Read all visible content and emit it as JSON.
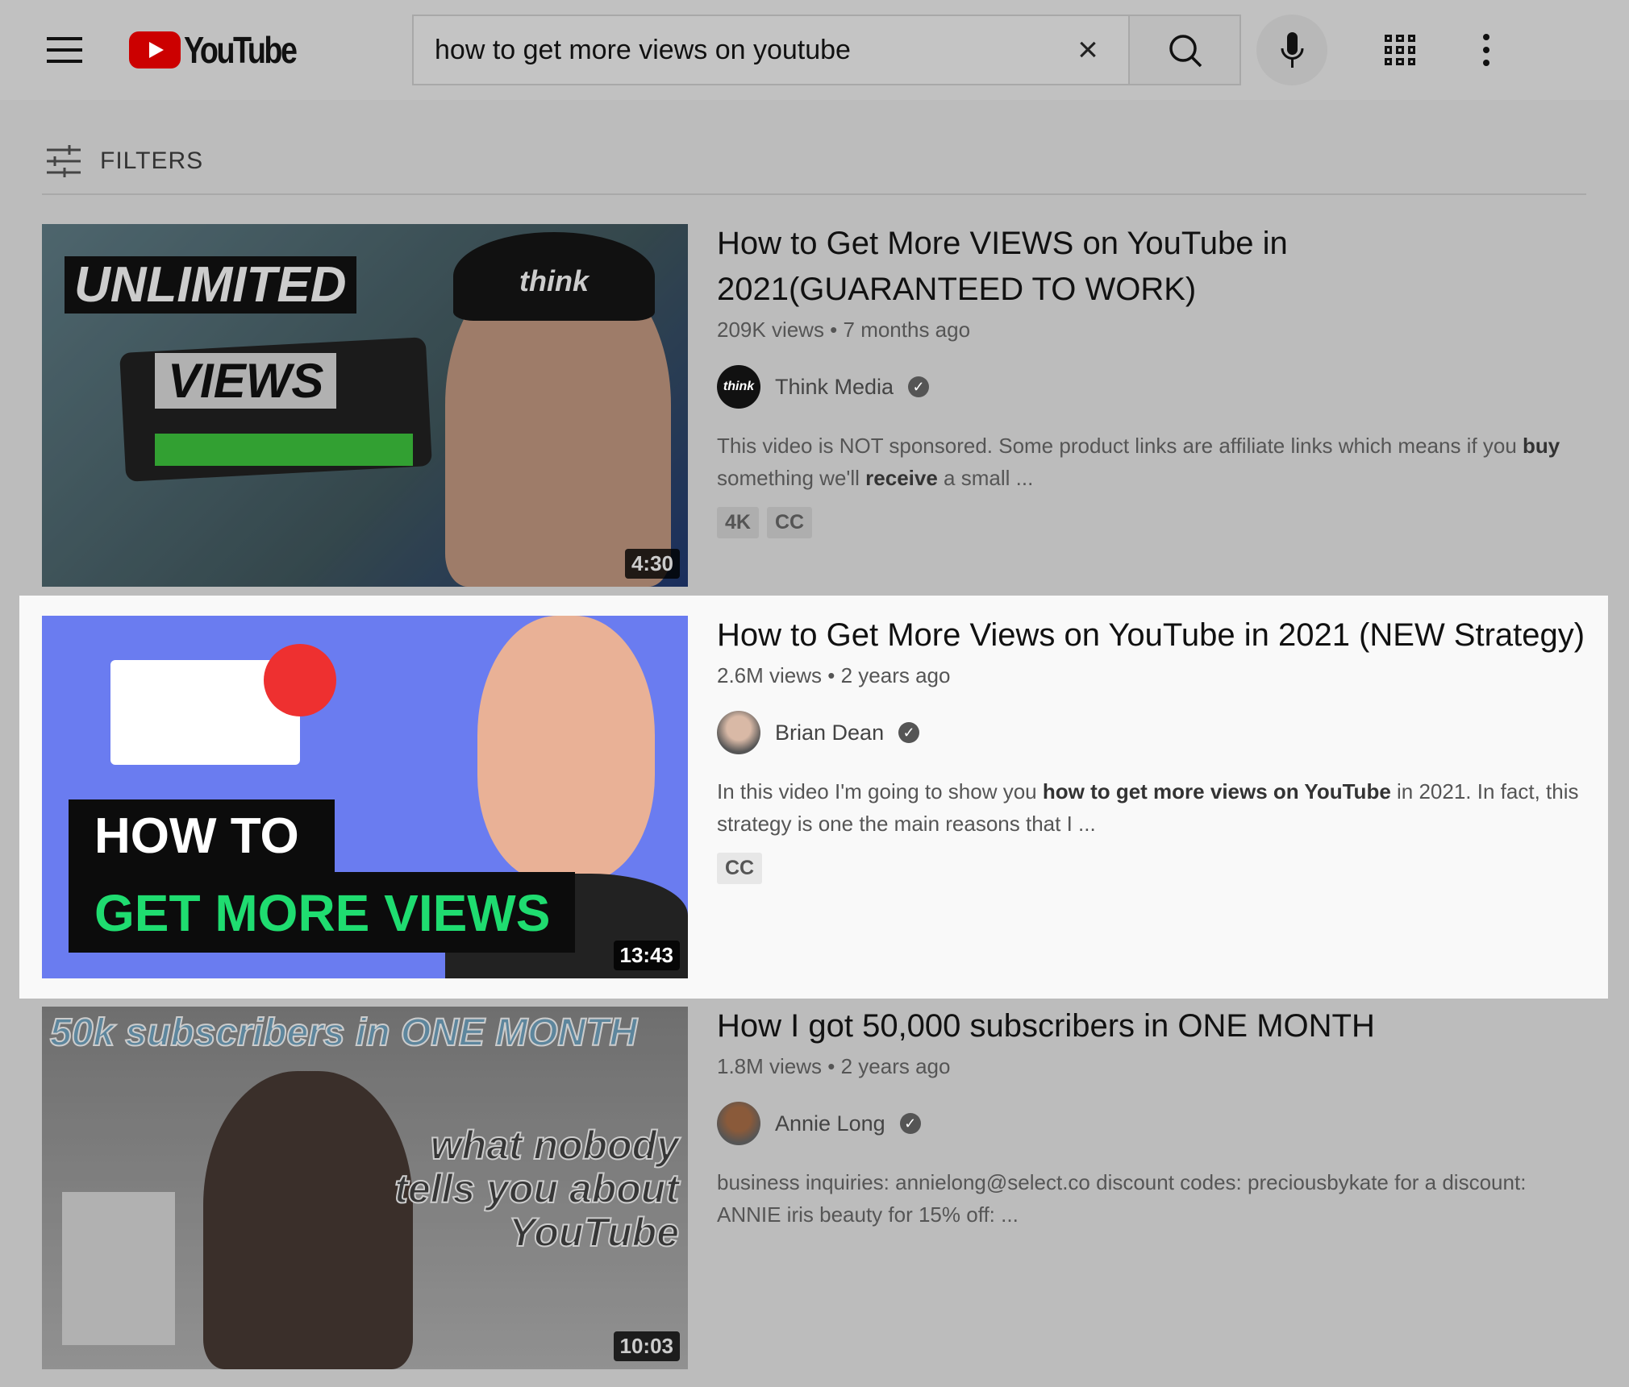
{
  "header": {
    "logo_text": "YouTube",
    "search_value": "how to get more views on youtube",
    "brand_color": "#cc0000"
  },
  "filters": {
    "label": "FILTERS"
  },
  "results": [
    {
      "title": "How to Get More VIEWS on YouTube in 2021(GUARANTEED TO WORK)",
      "meta": "209K views • 7 months ago",
      "channel": "Think Media",
      "avatar_text": "think",
      "desc": [
        {
          "t": "This video is NOT sponsored. Some product links are affiliate links which means if you "
        },
        {
          "t": "buy",
          "b": true
        },
        {
          "t": " something we'll "
        },
        {
          "t": "receive",
          "b": true
        },
        {
          "t": " a small ..."
        }
      ],
      "badges": [
        "4K",
        "CC"
      ],
      "duration": "4:30",
      "thumb_text": [
        "UNLIMITED",
        "VIEWS",
        "think"
      ],
      "highlighted": false
    },
    {
      "title": "How to Get More Views on YouTube in 2021 (NEW Strategy)",
      "meta": "2.6M views • 2 years ago",
      "channel": "Brian Dean",
      "desc": [
        {
          "t": "In this video I'm going to show you "
        },
        {
          "t": "how to get more views on YouTube",
          "b": true
        },
        {
          "t": " in 2021. In fact, this strategy is one the main reasons that I ..."
        }
      ],
      "badges": [
        "CC"
      ],
      "duration": "13:43",
      "thumb_text": [
        "HOW TO",
        "GET MORE VIEWS"
      ],
      "highlighted": true
    },
    {
      "title": "How I got 50,000 subscribers in ONE MONTH",
      "meta": "1.8M views • 2 years ago",
      "channel": "Annie Long",
      "desc": [
        {
          "t": "business inquiries: annielong@select.co discount codes: preciousbykate for a discount: ANNIE iris beauty for 15% off: ..."
        }
      ],
      "badges": [],
      "duration": "10:03",
      "thumb_text": [
        "50k subscribers in ONE MONTH",
        "what nobody tells you about YouTube"
      ],
      "highlighted": false
    }
  ]
}
